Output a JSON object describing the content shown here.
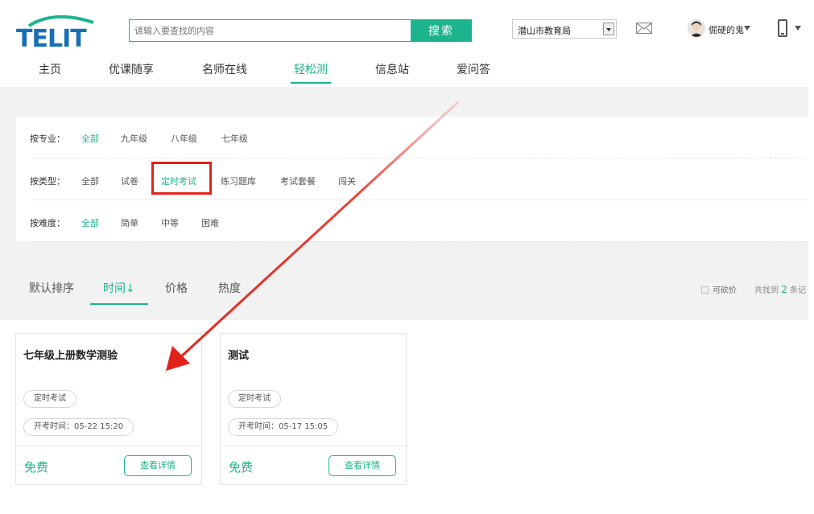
{
  "header": {
    "logo_text": "TELIT",
    "search_placeholder": "请输入要查找的内容",
    "search_button": "搜索",
    "region": "潜山市教育局",
    "username": "倔硬的鬼"
  },
  "nav": {
    "items": [
      {
        "label": "主页"
      },
      {
        "label": "优课随享"
      },
      {
        "label": "名师在线"
      },
      {
        "label": "轻松测"
      },
      {
        "label": "信息站"
      },
      {
        "label": "爱问答"
      }
    ],
    "active": "轻松测"
  },
  "filters": {
    "major": {
      "label": "按专业：",
      "options": [
        "全部",
        "九年级",
        "八年级",
        "七年级"
      ],
      "active": "全部"
    },
    "type": {
      "label": "按类型：",
      "options": [
        "全部",
        "试卷",
        "定时考试",
        "练习题库",
        "考试套餐",
        "闯关"
      ],
      "active": "定时考试"
    },
    "difficulty": {
      "label": "按难度：",
      "options": [
        "全部",
        "简单",
        "中等",
        "困难"
      ],
      "active": "全部"
    }
  },
  "sort": {
    "items": [
      "默认排序",
      "时间↓",
      "价格",
      "热度"
    ],
    "active": "时间↓",
    "bargain_label": "可砍价",
    "found_prefix": "共找到",
    "found_count": "2",
    "found_suffix": "条记"
  },
  "cards": [
    {
      "title": "七年级上册数学测验",
      "tag": "定时考试",
      "time": "开考时间：05-22 15:20",
      "price": "免费",
      "button": "查看详情"
    },
    {
      "title": "测试",
      "tag": "定时考试",
      "time": "开考时间：05-17 15:05",
      "price": "免费",
      "button": "查看详情"
    }
  ],
  "colors": {
    "accent": "#1cb48c",
    "annotation": "#e2231a"
  }
}
